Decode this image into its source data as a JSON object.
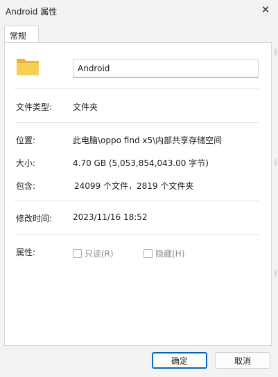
{
  "window": {
    "title": "Android 属性"
  },
  "tabs": [
    {
      "label": "常规"
    }
  ],
  "general": {
    "name_value": "Android",
    "type_label": "文件类型:",
    "type_value": "文件夹",
    "location_label": "位置:",
    "location_value": "此电脑\\oppo find x5\\内部共享存储空间",
    "size_label": "大小:",
    "size_value": "4.70 GB (5,053,854,043.00 字节)",
    "contains_label": "包含:",
    "contains_value": "24099 个文件，2819 个文件夹",
    "modified_label": "修改时间:",
    "modified_value": "2023/11/16 18:52",
    "attributes_label": "属性:",
    "readonly_label": "只读(R)",
    "hidden_label": "隐藏(H)"
  },
  "buttons": {
    "ok": "确定",
    "cancel": "取消"
  },
  "colors": {
    "accent": "#0067c0",
    "folder": "#f3c74b"
  }
}
